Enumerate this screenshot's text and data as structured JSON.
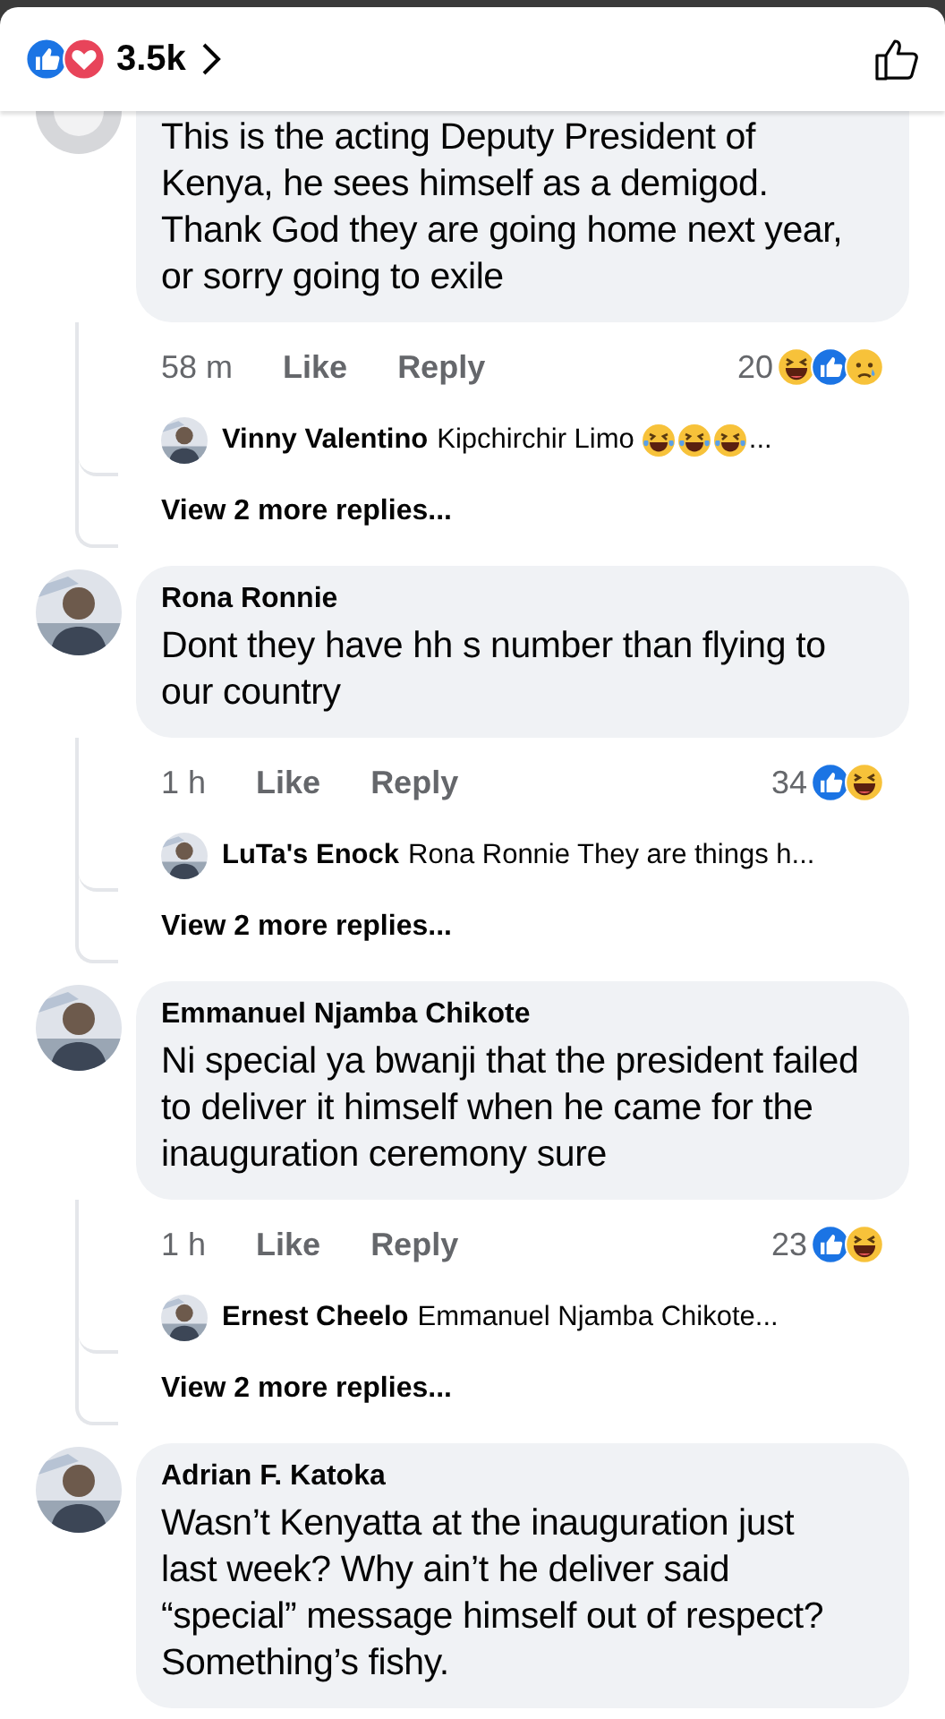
{
  "header": {
    "reactions": [
      {
        "kind": "like"
      },
      {
        "kind": "love"
      }
    ],
    "count": "3.5k"
  },
  "comments": [
    {
      "kind": "scrolled",
      "text": "This is the acting Deputy President of Kenya, he sees himself as a demigod. Thank God they are going home next year, or sorry going to exile",
      "time": "58 m",
      "like_label": "Like",
      "reply_label": "Reply",
      "reaction_count": "20",
      "reactions": [
        {
          "kind": "haha"
        },
        {
          "kind": "like"
        },
        {
          "kind": "sad"
        }
      ],
      "reply": {
        "author": "Vinny Valentino",
        "text": "Kipchirchir Limo",
        "emojis": [
          {
            "kind": "laugh-cry"
          },
          {
            "kind": "laugh-cry"
          },
          {
            "kind": "laugh-cry"
          }
        ],
        "ellipsis": "..."
      },
      "view_more": "View 2 more replies..."
    },
    {
      "kind": "full",
      "author": "Rona Ronnie",
      "text": "Dont they have hh s number than flying to our country",
      "time": "1 h",
      "like_label": "Like",
      "reply_label": "Reply",
      "reaction_count": "34",
      "reactions": [
        {
          "kind": "like"
        },
        {
          "kind": "haha"
        }
      ],
      "reply": {
        "author": "LuTa's Enock",
        "text": "Rona Ronnie They are things h..."
      },
      "view_more": "View 2 more replies..."
    },
    {
      "kind": "full",
      "author": "Emmanuel Njamba Chikote",
      "text": "Ni special ya bwanji that the president failed to deliver it himself when he came for the inauguration ceremony sure",
      "time": "1 h",
      "like_label": "Like",
      "reply_label": "Reply",
      "reaction_count": "23",
      "reactions": [
        {
          "kind": "like"
        },
        {
          "kind": "haha"
        }
      ],
      "reply": {
        "author": "Ernest Cheelo",
        "text": "Emmanuel Njamba Chikote..."
      },
      "view_more": "View 2 more replies..."
    },
    {
      "kind": "full",
      "author": "Adrian F. Katoka",
      "text": "Wasn’t Kenyatta at the inauguration just last week? Why ain’t he deliver said “special” message himself out of respect? Something’s fishy."
    }
  ]
}
